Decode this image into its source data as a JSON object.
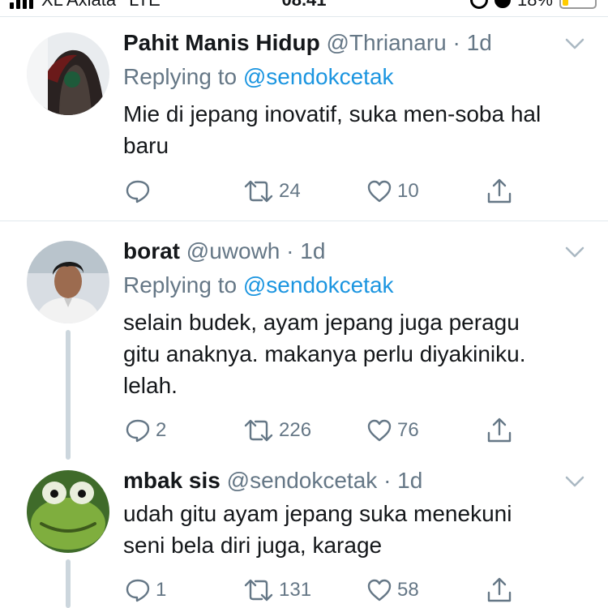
{
  "status_bar": {
    "carrier": "XL Axiata",
    "network": "LTE",
    "time": "08.41",
    "battery": "18%",
    "battery_level": 0.18
  },
  "colors": {
    "text": "#14171a",
    "secondary": "#657786",
    "link": "#1b95e0",
    "divider": "#e1e8ed",
    "thread_line": "#ccd6dd"
  },
  "tweets": [
    {
      "name": "Pahit Manis Hidup",
      "handle": "@Thrianaru",
      "separator": "·",
      "time": "1d",
      "replying_prefix": "Replying to",
      "replying_to": "@sendokcetak",
      "text_lines": [
        "Mie di jepang inovatif, suka men-soba hal",
        "baru"
      ],
      "replies": "",
      "retweets": "24",
      "likes": "10",
      "avatar_icon": "hooded-person-avatar"
    },
    {
      "name": "borat",
      "handle": "@uwowh",
      "separator": "·",
      "time": "1d",
      "replying_prefix": "Replying to",
      "replying_to": "@sendokcetak",
      "text_lines": [
        "selain budek, ayam jepang juga peragu",
        "gitu anaknya. makanya perlu diyakiniku.",
        "lelah."
      ],
      "replies": "2",
      "retweets": "226",
      "likes": "76",
      "avatar_icon": "young-man-avatar"
    },
    {
      "name": "mbak sis",
      "handle": "@sendokcetak",
      "separator": "·",
      "time": "1d",
      "text_lines": [
        "udah gitu ayam jepang suka menekuni",
        "seni bela diri juga, karage"
      ],
      "replies": "1",
      "retweets": "131",
      "likes": "58",
      "avatar_icon": "green-frog-avatar"
    }
  ]
}
